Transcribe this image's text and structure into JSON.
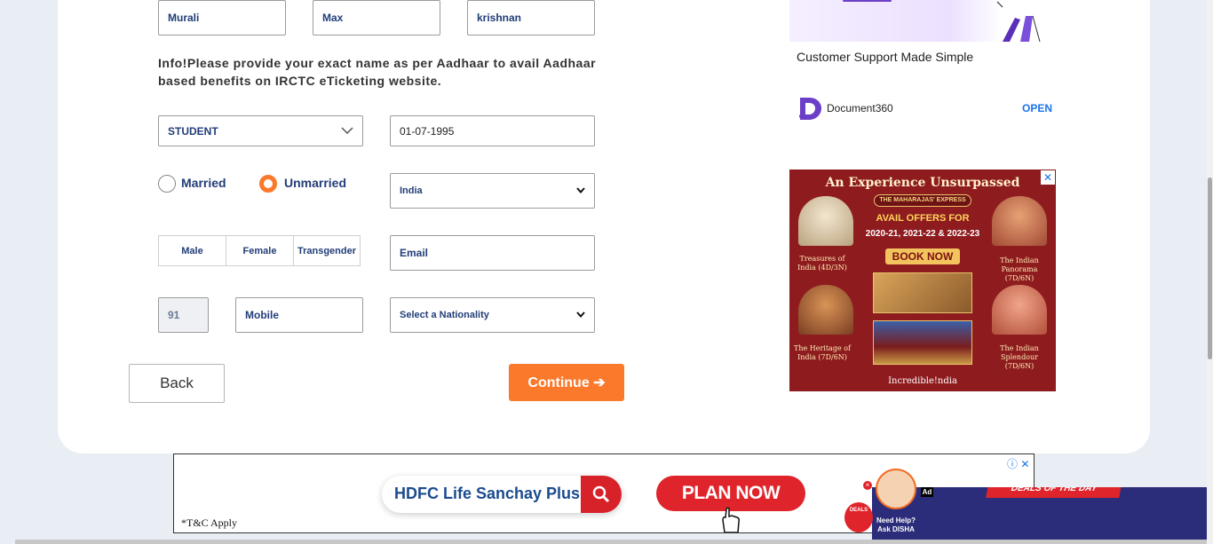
{
  "form": {
    "first_name": "Murali",
    "middle_name": "Max",
    "last_name": "krishnan",
    "info_text": "Info!Please provide your exact name as per Aadhaar to avail Aadhaar based benefits on IRCTC eTicketing website.",
    "occupation": "STUDENT",
    "dob": "01-07-1995",
    "marital": {
      "married_label": "Married",
      "unmarried_label": "Unmarried",
      "selected": "Unmarried"
    },
    "country": "India",
    "gender": {
      "male": "Male",
      "female": "Female",
      "transgender": "Transgender"
    },
    "email_placeholder": "Email",
    "isd_code": "91",
    "mobile_placeholder": "Mobile",
    "nationality": "Select a Nationality",
    "back_label": "Back",
    "continue_label": "Continue ➔"
  },
  "ad_top": {
    "title": "Customer Support Made Simple",
    "brand": "Document360",
    "cta": "OPEN",
    "colors": {
      "cta": "#1a73e8",
      "brand_purple": "#6b3fc8"
    }
  },
  "ad_maharajas": {
    "headline": "An Experience Unsurpassed",
    "pill": "THE MAHARAJAS' EXPRESS",
    "offer_line1": "AVAIL OFFERS FOR",
    "offer_line2": "2020-21, 2021-22 & 2022-23",
    "book_label": "BOOK NOW",
    "captions": {
      "treasures": "Treasures of India (4D/3N)",
      "panorama": "The Indian Panorama (7D/6N)",
      "heritage": "The Heritage of India (7D/6N)",
      "splendour": "The Indian Splendour (7D/6N)"
    },
    "footer": "Incredible!ndia",
    "colors": {
      "background": "#8e1c1f",
      "gold": "#f3c45e"
    }
  },
  "banner": {
    "search_text": "HDFC Life Sanchay Plus",
    "plan_label": "PLAN NOW",
    "tc": "*T&C Apply",
    "ad_label": "Ad",
    "deals_label": "DEALS OF THE DAY",
    "disha_label": "Need Help? Ask DISHA",
    "colors": {
      "red": "#e0242b",
      "navy": "#2b2c7a"
    }
  },
  "colors": {
    "primary_text": "#213d77",
    "accent_orange": "#fb792b",
    "page_bg": "#e9edf4"
  }
}
